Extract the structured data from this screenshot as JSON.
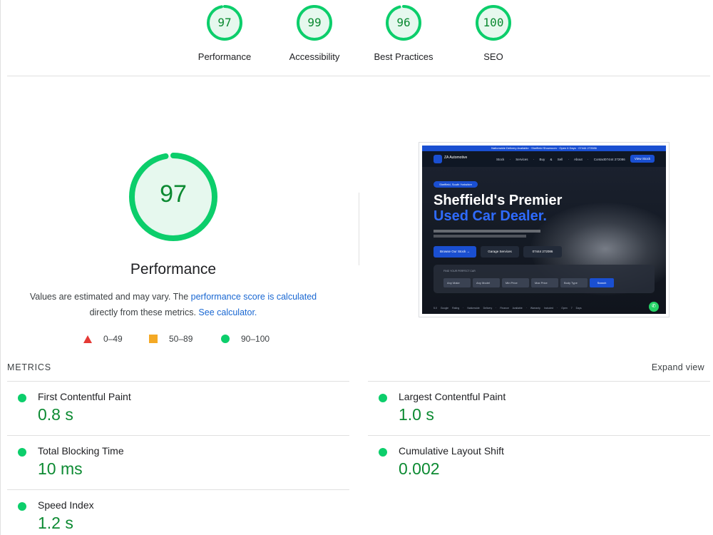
{
  "categories": [
    {
      "label": "Performance",
      "score": "97"
    },
    {
      "label": "Accessibility",
      "score": "99"
    },
    {
      "label": "Best Practices",
      "score": "96"
    },
    {
      "label": "SEO",
      "score": "100"
    }
  ],
  "performance": {
    "score": "97",
    "title": "Performance",
    "desc_prefix": "Values are estimated and may vary. The ",
    "desc_link1": "performance score is calculated",
    "desc_mid": "directly from these metrics. ",
    "desc_link2": "See calculator."
  },
  "legend": {
    "fail": "0–49",
    "average": "50–89",
    "pass": "90–100"
  },
  "colors": {
    "pass": "#0cce6b",
    "pass_text": "#0c8a32",
    "average": "#f4a925",
    "fail": "#e53935",
    "link": "#1967d2"
  },
  "screenshot": {
    "topbar": "Nationwide Delivery Available · Sheffield Showroom · Open 6 Days · 07444 272086",
    "logo": "ZA Automotive",
    "nav": "Stock · Services · Buy & Sell · About · Contact",
    "phone": "07444 272086",
    "stock_button": "View Stock",
    "pill": "Sheffield, South Yorkshire",
    "headline1": "Sheffield's Premier",
    "headline2": "Used Car Dealer.",
    "btn_browse": "Browse Our Stock →",
    "btn_garage": "Garage Services",
    "btn_phone": "07444 272086",
    "search_label": "FIND YOUR PERFECT CAR",
    "fields": [
      "Any Make",
      "Any Model",
      "Min Price",
      "Max Price",
      "Body Type"
    ],
    "search_button": "Search",
    "badges": "5.0 Google Rating · Nationwide Delivery · Finance Available · Warranty Included · Open 7 Days"
  },
  "metrics": {
    "heading": "METRICS",
    "expand": "Expand view",
    "items": [
      {
        "name": "First Contentful Paint",
        "value": "0.8 s"
      },
      {
        "name": "Largest Contentful Paint",
        "value": "1.0 s"
      },
      {
        "name": "Total Blocking Time",
        "value": "10 ms"
      },
      {
        "name": "Cumulative Layout Shift",
        "value": "0.002"
      },
      {
        "name": "Speed Index",
        "value": "1.2 s"
      }
    ]
  }
}
